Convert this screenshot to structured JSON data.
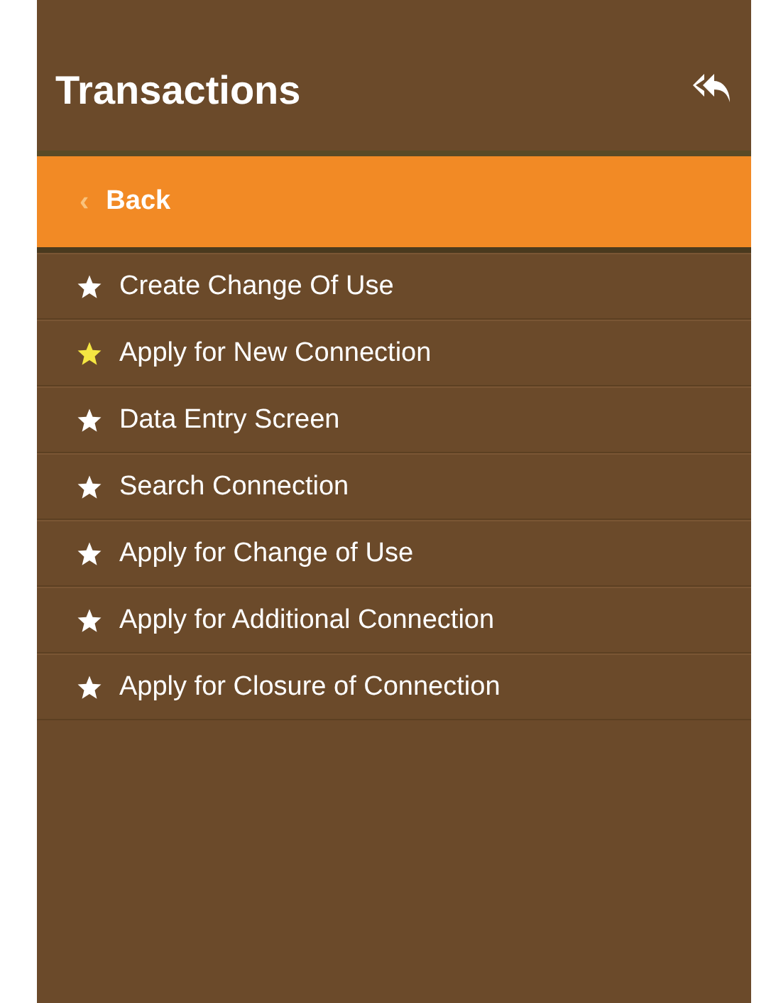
{
  "panel": {
    "title": "Transactions"
  },
  "back": {
    "label": "Back",
    "chevron": "‹"
  },
  "items": [
    {
      "label": "Create Change Of Use",
      "starred": false
    },
    {
      "label": "Apply for New Connection",
      "starred": true
    },
    {
      "label": "Data Entry Screen",
      "starred": false
    },
    {
      "label": "Search Connection",
      "starred": false
    },
    {
      "label": "Apply for Change of Use",
      "starred": false
    },
    {
      "label": "Apply for Additional Connection",
      "starred": false
    },
    {
      "label": "Apply for Closure of Connection",
      "starred": false
    }
  ]
}
